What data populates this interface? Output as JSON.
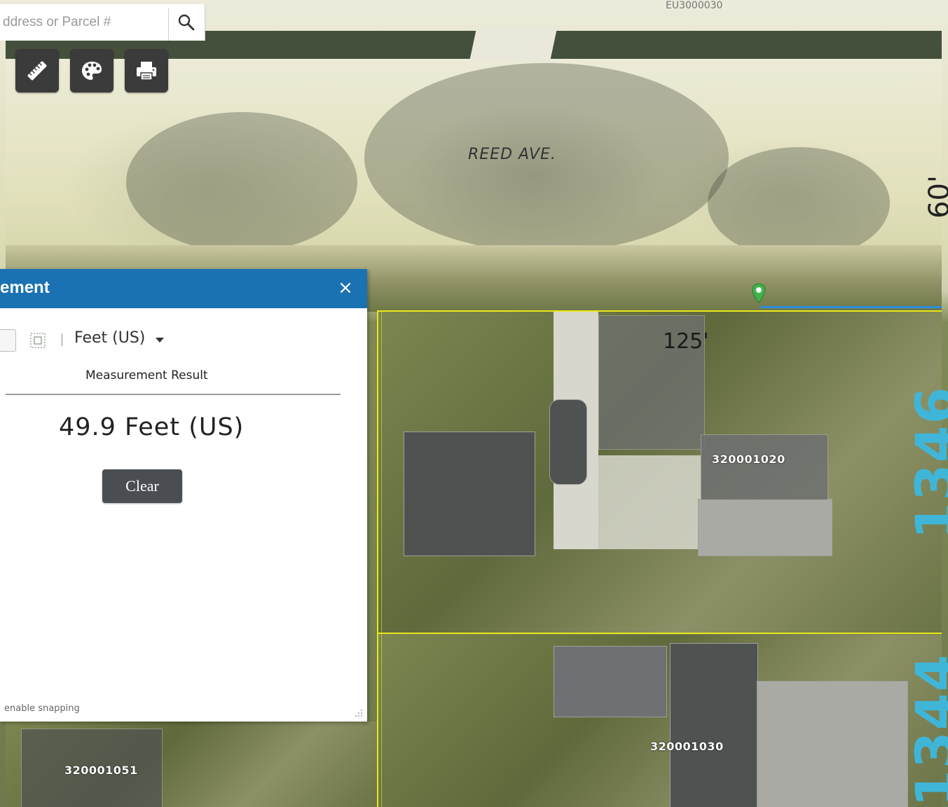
{
  "search": {
    "placeholder": "ddress or Parcel #"
  },
  "toolbar": {
    "buttons": [
      {
        "icon": "ruler-icon"
      },
      {
        "icon": "palette-icon"
      },
      {
        "icon": "printer-icon"
      }
    ]
  },
  "map": {
    "top_faint_text": "EU3000030",
    "street_label": "REED AVE.",
    "dim_label_125": "125'",
    "dim_label_60": "60'",
    "big_number_1": "1346",
    "big_number_2": "1344",
    "parcels": [
      "320001020",
      "320001030",
      "320001051"
    ]
  },
  "panel": {
    "title": "ement",
    "close_symbol": "×",
    "unit": "Feet (US)",
    "result_label": "Measurement Result",
    "result_value": "49.9 Feet (US)",
    "clear_label": "Clear",
    "snap_hint": "enable snapping"
  },
  "colors": {
    "panel_header": "#1b72b3",
    "parcel_line": "#e8e81a",
    "measure_line": "#2a8fe0",
    "number_label": "#3fb6d8"
  }
}
